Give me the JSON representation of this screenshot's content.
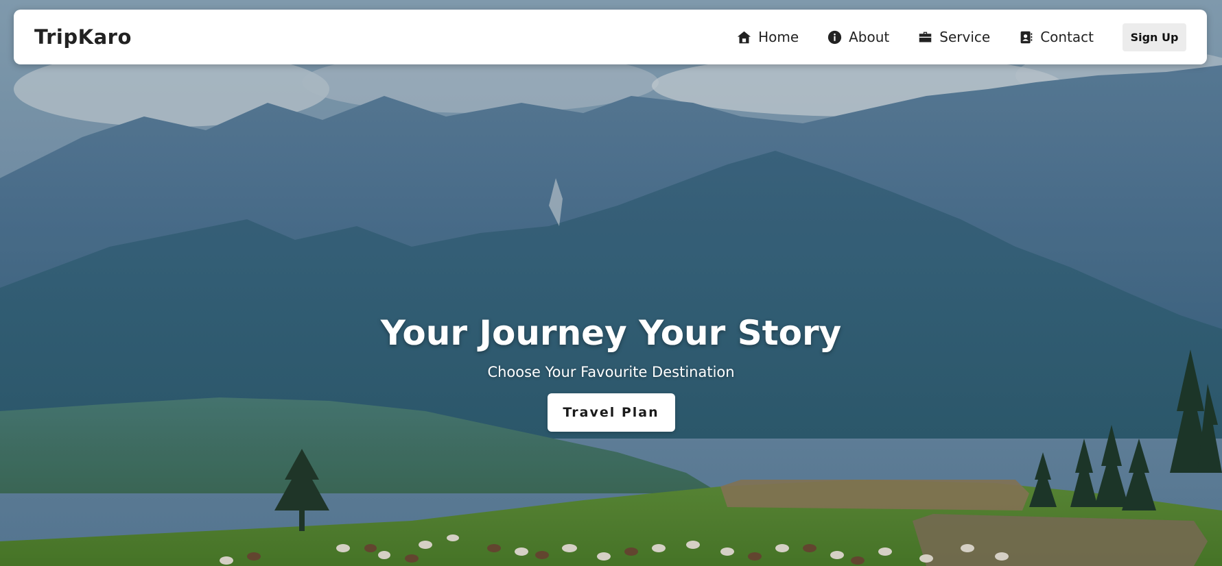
{
  "brand": {
    "name": "TripKaro"
  },
  "nav": {
    "items": [
      {
        "label": "Home",
        "icon": "home-icon"
      },
      {
        "label": "About",
        "icon": "info-icon"
      },
      {
        "label": "Service",
        "icon": "briefcase-icon"
      },
      {
        "label": "Contact",
        "icon": "contact-book-icon"
      }
    ],
    "signup_label": "Sign Up"
  },
  "hero": {
    "title": "Your Journey Your Story",
    "subtitle": "Choose Your Favourite Destination",
    "cta_label": "Travel Plan",
    "background_image": "mountain-landscape-with-grazing-sheep"
  },
  "colors": {
    "navbar_bg": "#ffffff",
    "text_dark": "#222222",
    "signup_bg": "#ececec",
    "hero_text": "#ffffff",
    "cta_bg": "#ffffff"
  }
}
